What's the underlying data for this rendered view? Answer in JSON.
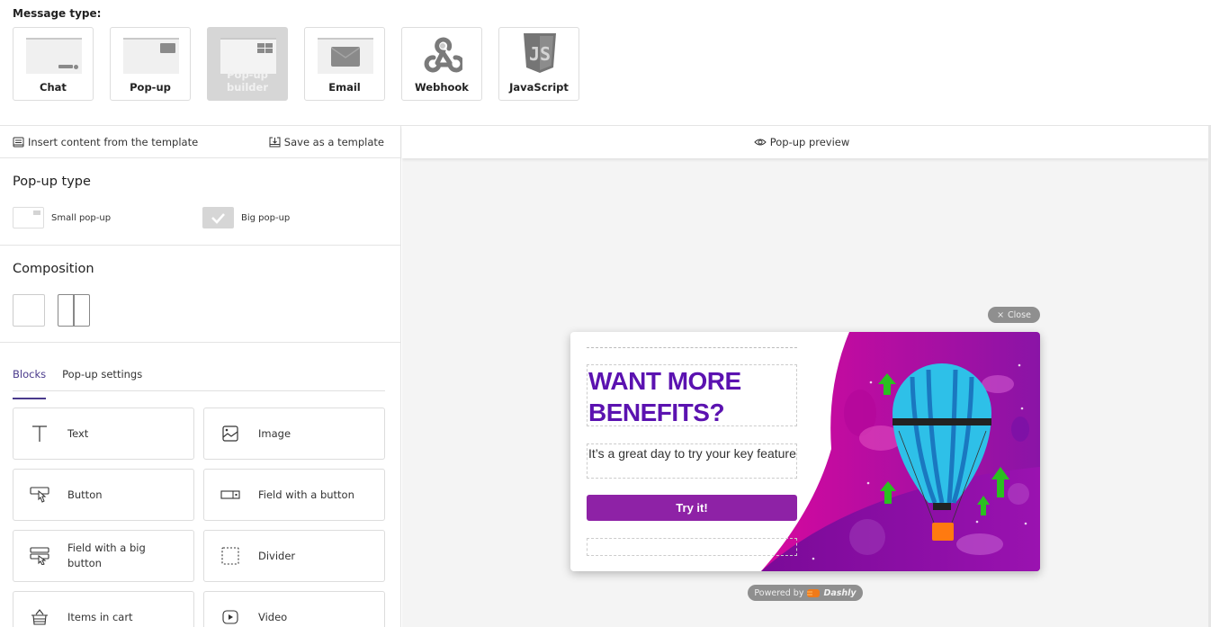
{
  "message_type": {
    "label": "Message type:",
    "options": [
      {
        "label": "Chat",
        "icon": "chat-widget-icon",
        "selected": false
      },
      {
        "label": "Pop-up",
        "icon": "popup-icon",
        "selected": false
      },
      {
        "label": "Pop-up builder",
        "icon": "popup-builder-icon",
        "selected": true
      },
      {
        "label": "Email",
        "icon": "envelope-icon",
        "selected": false
      },
      {
        "label": "Webhook",
        "icon": "webhook-icon",
        "selected": false
      },
      {
        "label": "JavaScript",
        "icon": "javascript-icon",
        "selected": false
      }
    ]
  },
  "template_bar": {
    "insert_label": "Insert content from the template",
    "save_label": "Save as a template"
  },
  "popup_type": {
    "title": "Pop-up type",
    "options": [
      {
        "label": "Small pop-up",
        "selected": false
      },
      {
        "label": "Big pop-up",
        "selected": true
      }
    ]
  },
  "composition": {
    "title": "Composition",
    "options": [
      "single-column",
      "two-column"
    ]
  },
  "tabs": [
    {
      "label": "Blocks",
      "active": true
    },
    {
      "label": "Pop-up settings",
      "active": false
    }
  ],
  "blocks": [
    {
      "label": "Text",
      "icon": "text-icon"
    },
    {
      "label": "Image",
      "icon": "image-icon"
    },
    {
      "label": "Button",
      "icon": "button-click-icon"
    },
    {
      "label": "Field with a button",
      "icon": "field-button-icon"
    },
    {
      "label": "Field with a big button",
      "icon": "field-big-button-icon"
    },
    {
      "label": "Divider",
      "icon": "divider-icon"
    },
    {
      "label": "Items in cart",
      "icon": "basket-icon"
    },
    {
      "label": "Video",
      "icon": "video-icon"
    }
  ],
  "preview": {
    "title": "Pop-up preview",
    "close_label": "Close",
    "headline": "WANT MORE BENEFITS?",
    "subtext": "It’s a great day to try your key feature",
    "cta_label": "Try it!",
    "powered_by": "Powered by",
    "brand": "Dashly",
    "colors": {
      "headline": "#5b12b0",
      "cta": "#8e22a6",
      "art_magenta": "#d6089e",
      "art_purple": "#8a14a6"
    }
  }
}
